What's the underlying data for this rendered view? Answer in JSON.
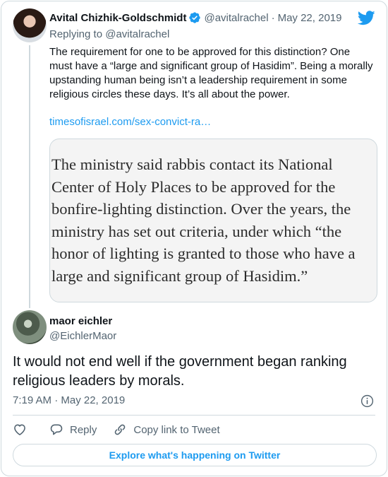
{
  "parent": {
    "name": "Avital Chizhik-Goldschmidt",
    "handle": "@avitalrachel",
    "separator": "·",
    "date": "May 22, 2019",
    "replying_to": "Replying to @avitalrachel",
    "text": "The requirement for one to be approved for this distinction? One must have a “large and significant group of Hasidim”. Being a morally upstanding human being isn’t a leadership requirement in some religious circles these days. It’s all about the power.",
    "link": "timesofisrael.com/sex-convict-ra…",
    "quote_image_text": "The ministry said rabbis contact its National Center of Holy Places to be approved for the bonfire-lighting distinction. Over the years, the ministry has set out criteria, under which “the honor of lighting is granted to those who have a large and significant group of Hasidim.”"
  },
  "tweet": {
    "name": "maor eichler",
    "handle": "@EichlerMaor",
    "text": "It would not end well if the government began ranking religious leaders by morals.",
    "timestamp": "7:19 AM · May 22, 2019"
  },
  "actions": {
    "reply": "Reply",
    "copy_link": "Copy link to Tweet"
  },
  "explore_label": "Explore what's happening on Twitter",
  "colors": {
    "accent": "#1d9bf0",
    "text": "#0f1419",
    "muted": "#536471",
    "border": "#cfd9de"
  },
  "icons": [
    "verified-badge-icon",
    "twitter-bird-icon",
    "info-icon",
    "heart-icon",
    "reply-bubble-icon",
    "link-icon"
  ]
}
